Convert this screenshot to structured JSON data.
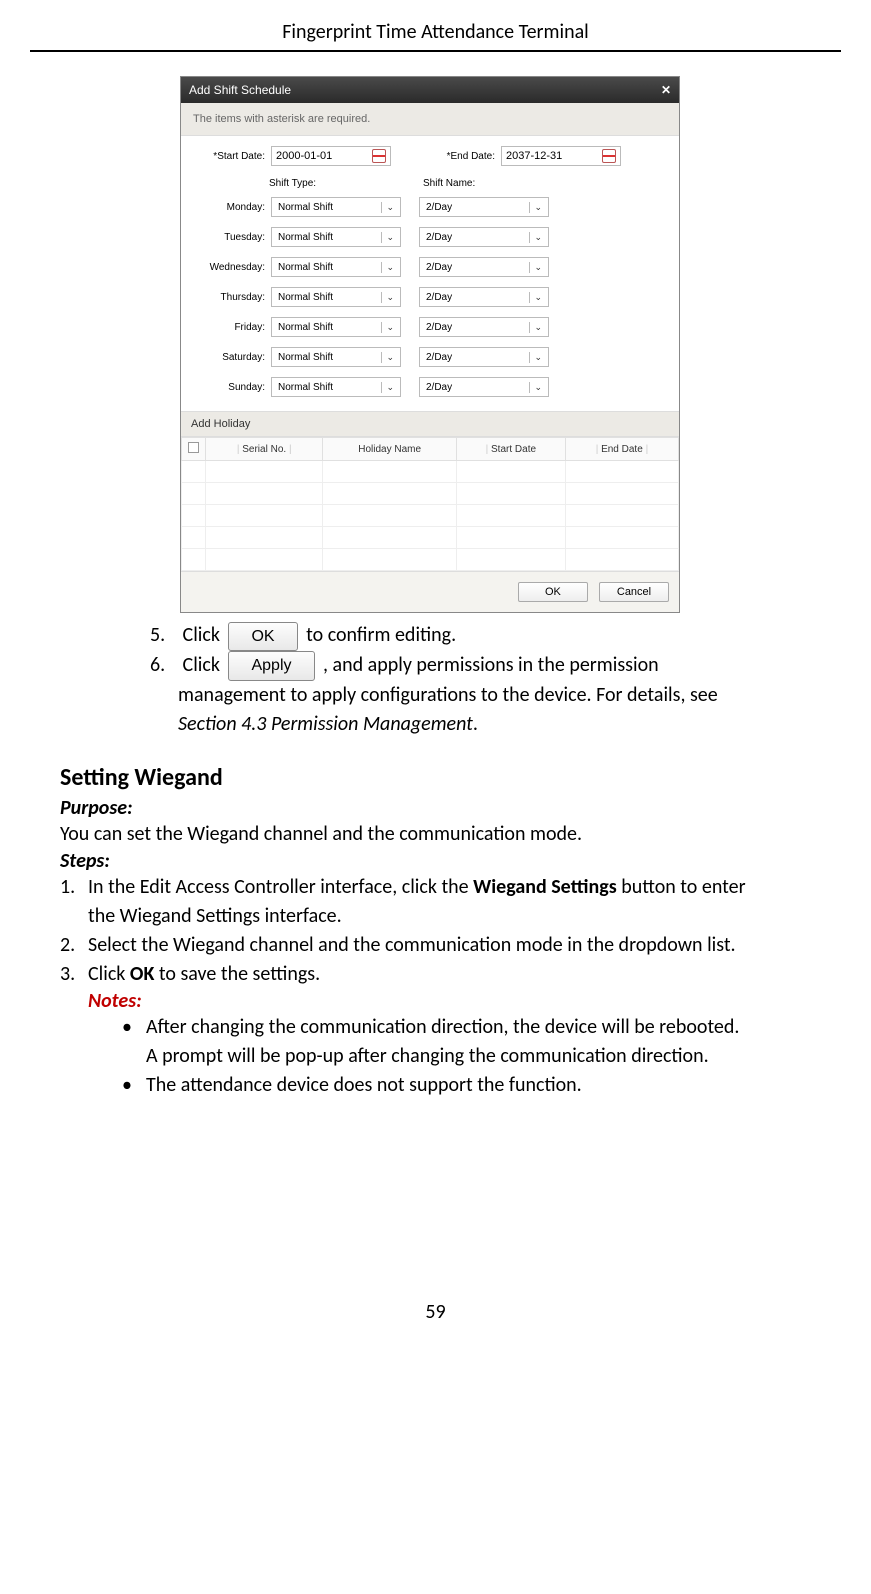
{
  "header": {
    "title": "Fingerprint Time Attendance Terminal"
  },
  "dialog": {
    "title": "Add Shift Schedule",
    "info": "The items with asterisk are required.",
    "start_date_label": "*Start Date:",
    "start_date_value": "2000-01-01",
    "end_date_label": "*End Date:",
    "end_date_value": "2037-12-31",
    "shift_type_header": "Shift Type:",
    "shift_name_header": "Shift Name:",
    "days": [
      {
        "label": "Monday:",
        "type": "Normal Shift",
        "name": "2/Day"
      },
      {
        "label": "Tuesday:",
        "type": "Normal Shift",
        "name": "2/Day"
      },
      {
        "label": "Wednesday:",
        "type": "Normal Shift",
        "name": "2/Day"
      },
      {
        "label": "Thursday:",
        "type": "Normal Shift",
        "name": "2/Day"
      },
      {
        "label": "Friday:",
        "type": "Normal Shift",
        "name": "2/Day"
      },
      {
        "label": "Saturday:",
        "type": "Normal Shift",
        "name": "2/Day"
      },
      {
        "label": "Sunday:",
        "type": "Normal Shift",
        "name": "2/Day"
      }
    ],
    "add_holiday_label": "Add Holiday",
    "holiday_headers": {
      "serial": "Serial No.",
      "name": "Holiday Name",
      "start": "Start Date",
      "end": "End Date"
    },
    "footer": {
      "ok": "OK",
      "cancel": "Cancel"
    }
  },
  "steps_upper": {
    "s5_num": "5.",
    "s5_a": "Click",
    "s5_btn": "OK",
    "s5_b": "to confirm editing.",
    "s6_num": "6.",
    "s6_a": "Click",
    "s6_btn": "Apply",
    "s6_b": ", and apply permissions in the permission",
    "s6_c": "management to apply configurations to the device. For details, see",
    "s6_d": "Section 4.3 Permission Management",
    "s6_e": "."
  },
  "wiegand": {
    "heading": "Setting Wiegand",
    "purpose_label": "Purpose:",
    "purpose_text": "You can set the Wiegand channel and the communication mode.",
    "steps_label": "Steps:",
    "s1_n": "1.",
    "s1_a": "In the Edit Access Controller interface, click the ",
    "s1_bold": "Wiegand Settings",
    "s1_b": " button to enter",
    "s1_c": "the Wiegand Settings interface.",
    "s2_n": "2.",
    "s2_a": "Select the Wiegand channel and the communication mode in the dropdown list.",
    "s3_n": "3.",
    "s3_a": "Click ",
    "s3_bold": "OK",
    "s3_b": " to save the settings.",
    "notes_label": "Notes:",
    "note1a": "After changing the communication direction, the device will be rebooted.",
    "note1b": "A prompt will be pop-up after changing the communication direction.",
    "note2": "The attendance device does not support the function."
  },
  "page_number": "59"
}
